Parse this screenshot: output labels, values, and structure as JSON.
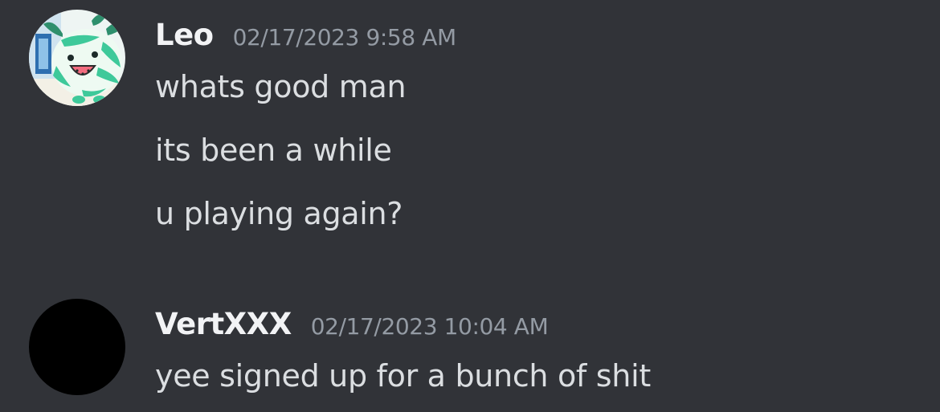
{
  "messages": [
    {
      "author": "Leo",
      "timestamp": "02/17/2023 9:58 AM",
      "avatar_icon": "watermelon-creature-avatar",
      "lines": [
        "whats good man",
        "its been a while",
        "u playing again?"
      ]
    },
    {
      "author": "VertXXX",
      "timestamp": "02/17/2023 10:04 AM",
      "avatar_icon": "black-circle-avatar",
      "lines": [
        "yee signed up for a bunch of shit"
      ]
    }
  ],
  "colors": {
    "background": "#313338",
    "username": "#f2f3f5",
    "timestamp": "#949ba4",
    "message_text": "#dbdee1"
  }
}
